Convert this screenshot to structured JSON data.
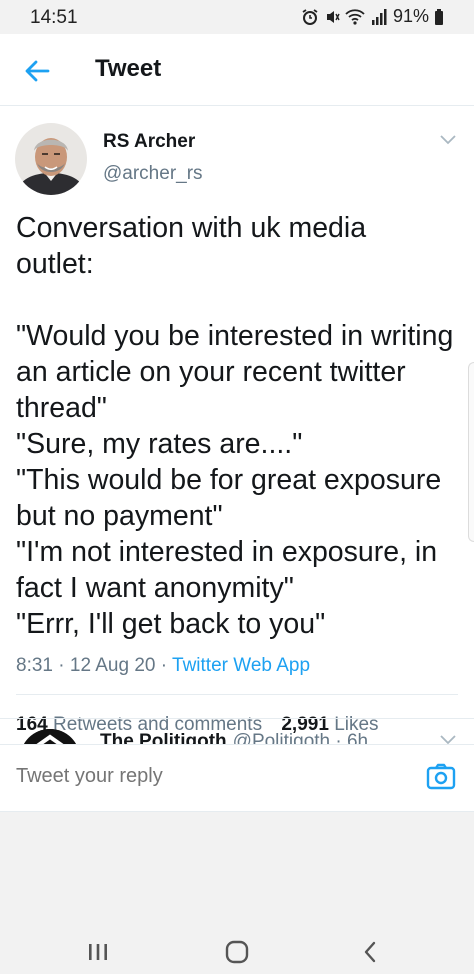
{
  "status_bar": {
    "time": "14:51",
    "battery": "91%"
  },
  "header": {
    "title": "Tweet"
  },
  "tweet": {
    "author_name": "RS Archer",
    "author_handle": "@archer_rs",
    "lines": [
      "Conversation with uk media",
      "outlet:",
      "",
      "\"Would you be interested in writing",
      "an article on your recent twitter",
      "thread\"",
      "\"Sure, my rates are....\"",
      "\"This would be for great exposure",
      "but no payment\"",
      "\"I'm not interested in exposure, in",
      "fact I want anonymity\"",
      "\"Errr, I'll get back to you\""
    ],
    "time": "8:31",
    "date": "12 Aug 20",
    "separator": "·",
    "source": "Twitter Web App",
    "retweets_count": "164",
    "retweets_label": "Retweets and comments",
    "likes_count": "2,991",
    "likes_label": "Likes"
  },
  "next_tweet": {
    "name": "The Politigoth",
    "handle": "@Politigoth · 6h"
  },
  "reply": {
    "placeholder": "Tweet your reply"
  },
  "icons": {
    "back": "back-arrow-icon",
    "chevron": "chevron-down-icon",
    "reply": "reply-icon",
    "retweet": "retweet-icon",
    "like": "heart-icon",
    "share": "share-icon",
    "camera": "camera-icon",
    "nav_recents": "recents-icon",
    "nav_home": "home-icon",
    "nav_back": "nav-back-icon"
  },
  "colors": {
    "accent": "#1da1f2",
    "like": "#e0245e",
    "secondary_text": "#657786",
    "primary_text": "#14171a"
  }
}
